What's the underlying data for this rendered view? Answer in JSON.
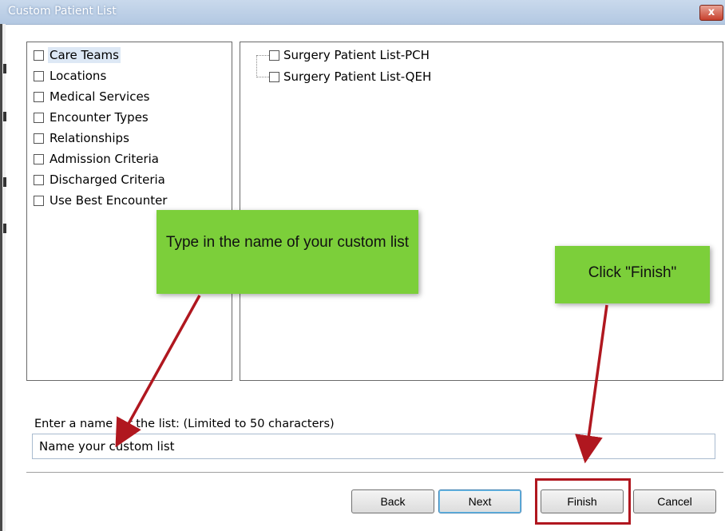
{
  "window": {
    "title": "Custom Patient List",
    "close_glyph": "x"
  },
  "left_list": {
    "items": [
      {
        "label": "Care Teams",
        "selected": true
      },
      {
        "label": "Locations"
      },
      {
        "label": "Medical Services"
      },
      {
        "label": "Encounter Types"
      },
      {
        "label": "Relationships"
      },
      {
        "label": "Admission Criteria"
      },
      {
        "label": "Discharged Criteria"
      },
      {
        "label": "Use Best Encounter"
      }
    ]
  },
  "right_tree": {
    "items": [
      {
        "label": "Surgery Patient List-PCH"
      },
      {
        "label": "Surgery Patient List-QEH"
      }
    ]
  },
  "callouts": {
    "name_hint": "Type in the name of your custom list",
    "finish_hint": "Click \"Finish\""
  },
  "name_field": {
    "label": "Enter a name for the list: (Limited to 50 characters)",
    "value": "Name your custom list"
  },
  "buttons": {
    "back": "Back",
    "next": "Next",
    "finish": "Finish",
    "cancel": "Cancel"
  },
  "colors": {
    "callout_green": "#7ccf3a",
    "arrow_red": "#b0171f",
    "highlight_box": "#b0171f"
  }
}
